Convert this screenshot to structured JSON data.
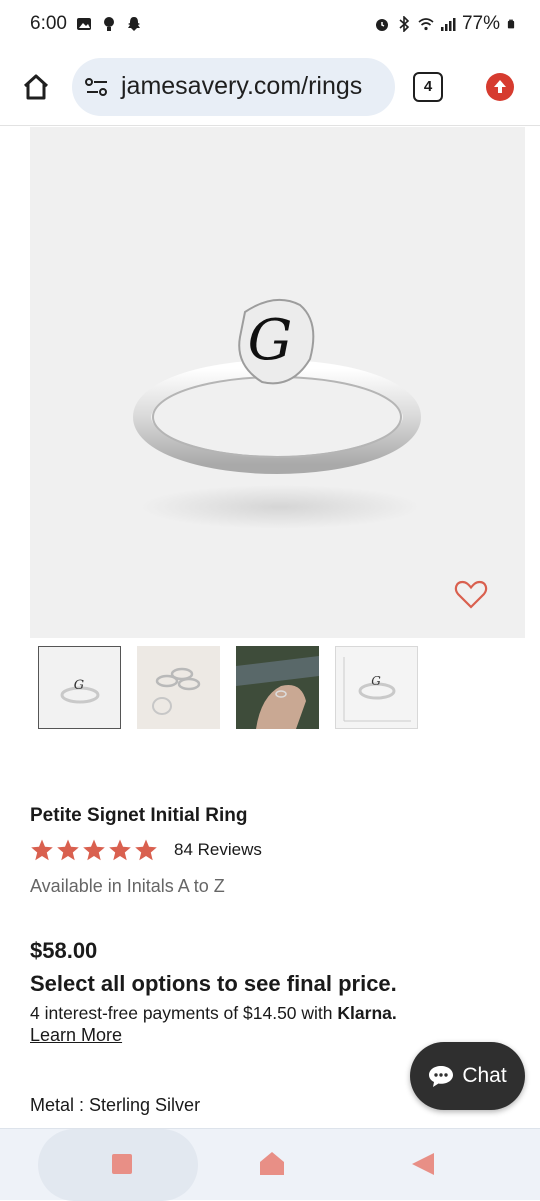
{
  "status_bar": {
    "time": "6:00",
    "battery": "77%",
    "left_icons": [
      "gallery-icon",
      "bulb-icon",
      "snapchat-icon"
    ],
    "right_icons": [
      "alarm-icon",
      "bluetooth-icon",
      "wifi-icon",
      "signal-icon",
      "battery-icon"
    ]
  },
  "browser": {
    "url": "jamesavery.com/rings",
    "tab_count": "4"
  },
  "product": {
    "title": "Petite Signet Initial Ring",
    "rating": 5,
    "reviews": "84 Reviews",
    "availability": "Available in Initals A to Z",
    "price": "$58.00",
    "price_note": "Select all options to see final price.",
    "installments_prefix": "4 interest-free payments of $14.50 with",
    "klarna": "Klarna.",
    "learn_more": "Learn More",
    "metal": "Metal : Sterling Silver",
    "engraving_letter": "G"
  },
  "thumbnails": [
    {
      "name": "ring-front-view",
      "selected": true
    },
    {
      "name": "rings-stacked-view",
      "selected": false
    },
    {
      "name": "ring-on-hand-view",
      "selected": false
    },
    {
      "name": "ring-size-chart-view",
      "selected": false
    }
  ],
  "chat": {
    "label": "Chat"
  },
  "colors": {
    "accent": "#d9604f",
    "star": "#d9604f",
    "chat_bg": "#2f2f2f",
    "url_bg": "#e8eef6",
    "nav_icon": "#e88f86"
  }
}
